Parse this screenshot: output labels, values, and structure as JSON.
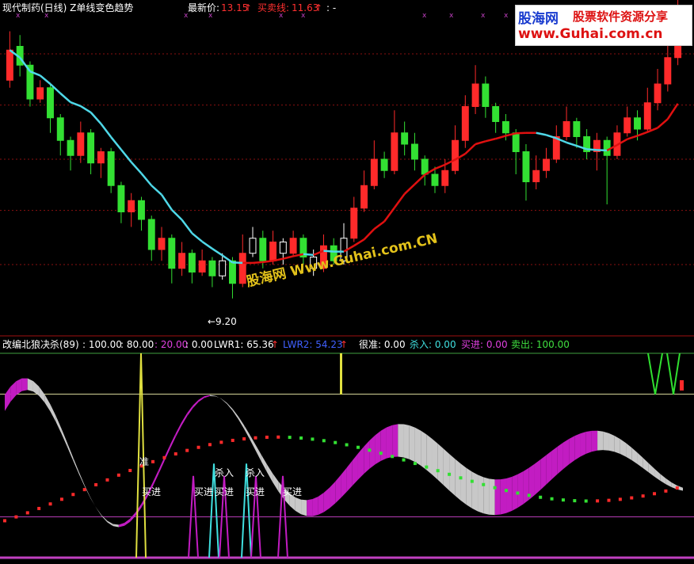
{
  "header": {
    "stock_title": "现代制药(日线) Z单线变色趋势",
    "latest_price_label": "最新价:",
    "latest_price_value": "13.15",
    "buy_sell_label": "买卖线:",
    "buy_sell_value": "11.63",
    "extra": ": -"
  },
  "logo": {
    "site_cn": "股海网",
    "site_tag": "股票软件资源分享",
    "site_url": "www.Guhai.com.cn"
  },
  "watermark": "股海网 Www.Guhai.com.CN",
  "low_price_label": "←9.20",
  "indicator_header": {
    "name": "改编北狼决杀(89)",
    "v1": ": 100.00",
    "v2": ": 80.00",
    "v3": ": 20.00",
    "v4": ": 0.00",
    "lwr1": "LWR1: 65.36",
    "lwr2": "LWR2: 54.23",
    "zhun": "很准: 0.00",
    "sharu": "杀入: 0.00",
    "maijin": "买进: 0.00",
    "maichu": "卖出: 100.00"
  },
  "signal_labels": {
    "zhun": "准",
    "maijin": "买进",
    "sharu": "杀入"
  },
  "colors": {
    "up": "#ff2a2a",
    "down": "#33e033",
    "hollow": "#ffffff",
    "ma_cyan": "#4fd8e8",
    "ma_red": "#e01010",
    "band_magenta": "#c21cc2",
    "band_gray": "#c8c8c8",
    "grid": "#8a1010",
    "level_line": "#c040c0"
  },
  "chart_data": [
    {
      "type": "candlestick",
      "title": "现代制药(日线)",
      "price_range": [
        8.5,
        16.5
      ],
      "low_marker": 9.2,
      "candles_o_c_h_l": [
        [
          15.0,
          15.8,
          16.3,
          14.8
        ],
        [
          15.9,
          15.4,
          16.2,
          15.1
        ],
        [
          15.4,
          14.5,
          15.5,
          14.3
        ],
        [
          14.5,
          14.8,
          15.0,
          14.4
        ],
        [
          14.8,
          14.0,
          14.9,
          13.6
        ],
        [
          14.0,
          13.4,
          14.1,
          13.0
        ],
        [
          13.4,
          13.0,
          13.5,
          12.6
        ],
        [
          13.0,
          13.6,
          13.9,
          12.8
        ],
        [
          13.6,
          12.8,
          13.7,
          12.5
        ],
        [
          12.8,
          13.1,
          13.2,
          12.4
        ],
        [
          13.1,
          12.2,
          13.2,
          12.0
        ],
        [
          12.2,
          11.5,
          12.3,
          11.2
        ],
        [
          11.5,
          11.8,
          12.0,
          11.1
        ],
        [
          11.8,
          11.3,
          11.9,
          11.0
        ],
        [
          11.3,
          10.5,
          11.4,
          10.2
        ],
        [
          10.5,
          10.8,
          11.1,
          10.2
        ],
        [
          10.8,
          10.0,
          10.9,
          9.6
        ],
        [
          10.0,
          10.4,
          10.7,
          9.8
        ],
        [
          10.4,
          9.9,
          10.5,
          9.6
        ],
        [
          9.9,
          10.2,
          10.5,
          9.8
        ],
        [
          10.2,
          9.8,
          10.3,
          9.5
        ],
        [
          9.8,
          10.2,
          10.4,
          9.7
        ],
        [
          10.2,
          9.6,
          10.3,
          9.2
        ],
        [
          9.6,
          10.4,
          10.9,
          9.5
        ],
        [
          10.4,
          10.8,
          11.1,
          10.3
        ],
        [
          10.8,
          10.2,
          11.0,
          10.0
        ],
        [
          10.2,
          10.7,
          11.0,
          10.1
        ],
        [
          10.7,
          10.4,
          10.8,
          10.1
        ],
        [
          10.4,
          10.8,
          11.0,
          10.3
        ],
        [
          10.8,
          10.3,
          10.9,
          10.1
        ],
        [
          10.3,
          10.0,
          10.5,
          9.8
        ],
        [
          10.0,
          10.6,
          10.9,
          9.9
        ],
        [
          10.6,
          10.2,
          10.8,
          10.1
        ],
        [
          10.2,
          10.8,
          11.2,
          10.1
        ],
        [
          10.8,
          11.6,
          11.9,
          10.7
        ],
        [
          11.6,
          12.2,
          12.6,
          11.5
        ],
        [
          12.2,
          12.9,
          13.4,
          12.1
        ],
        [
          12.9,
          12.6,
          13.1,
          12.4
        ],
        [
          12.6,
          13.6,
          14.2,
          12.5
        ],
        [
          13.6,
          13.3,
          13.9,
          13.0
        ],
        [
          13.3,
          12.9,
          13.6,
          12.6
        ],
        [
          12.9,
          12.5,
          13.0,
          12.2
        ],
        [
          12.5,
          12.2,
          12.7,
          12.0
        ],
        [
          12.2,
          12.6,
          12.9,
          12.0
        ],
        [
          12.6,
          13.4,
          13.8,
          12.5
        ],
        [
          13.4,
          14.3,
          14.6,
          13.2
        ],
        [
          14.3,
          14.9,
          15.4,
          14.1
        ],
        [
          14.9,
          14.3,
          15.1,
          14.0
        ],
        [
          14.3,
          13.9,
          14.4,
          13.6
        ],
        [
          13.9,
          13.6,
          14.1,
          13.4
        ],
        [
          13.6,
          13.1,
          13.7,
          12.5
        ],
        [
          13.1,
          12.3,
          13.3,
          11.8
        ],
        [
          12.3,
          12.6,
          13.0,
          12.1
        ],
        [
          12.6,
          12.9,
          13.2,
          12.4
        ],
        [
          12.9,
          13.5,
          13.8,
          12.8
        ],
        [
          13.5,
          13.9,
          14.3,
          13.4
        ],
        [
          13.9,
          13.5,
          14.0,
          13.2
        ],
        [
          13.5,
          13.1,
          13.7,
          12.9
        ],
        [
          13.1,
          13.4,
          13.6,
          12.6
        ],
        [
          13.4,
          13.0,
          13.5,
          11.7
        ],
        [
          13.0,
          13.6,
          13.8,
          12.9
        ],
        [
          13.6,
          14.0,
          14.3,
          13.5
        ],
        [
          14.0,
          13.7,
          14.2,
          13.4
        ],
        [
          13.7,
          14.4,
          14.8,
          13.6
        ],
        [
          14.4,
          14.9,
          15.3,
          14.2
        ],
        [
          14.9,
          15.6,
          16.1,
          14.7
        ],
        [
          15.6,
          16.8,
          17.2,
          15.4
        ]
      ],
      "moving_average_color_change": "cyan when falling, red when rising"
    },
    {
      "type": "oscillator",
      "title": "改编北狼决杀(89)",
      "levels": [
        100,
        80,
        20,
        0
      ],
      "series": [
        {
          "name": "LWR1",
          "last_value": 65.36
        },
        {
          "name": "LWR2",
          "last_value": 54.23
        },
        {
          "name": "很准",
          "last_value": 0
        },
        {
          "name": "杀入",
          "last_value": 0
        },
        {
          "name": "买进",
          "last_value": 0
        },
        {
          "name": "卖出",
          "last_value": 100
        }
      ],
      "signals": [
        "准",
        "买进",
        "买进",
        "杀入",
        "买进",
        "杀入",
        "买进",
        "买进"
      ]
    }
  ]
}
